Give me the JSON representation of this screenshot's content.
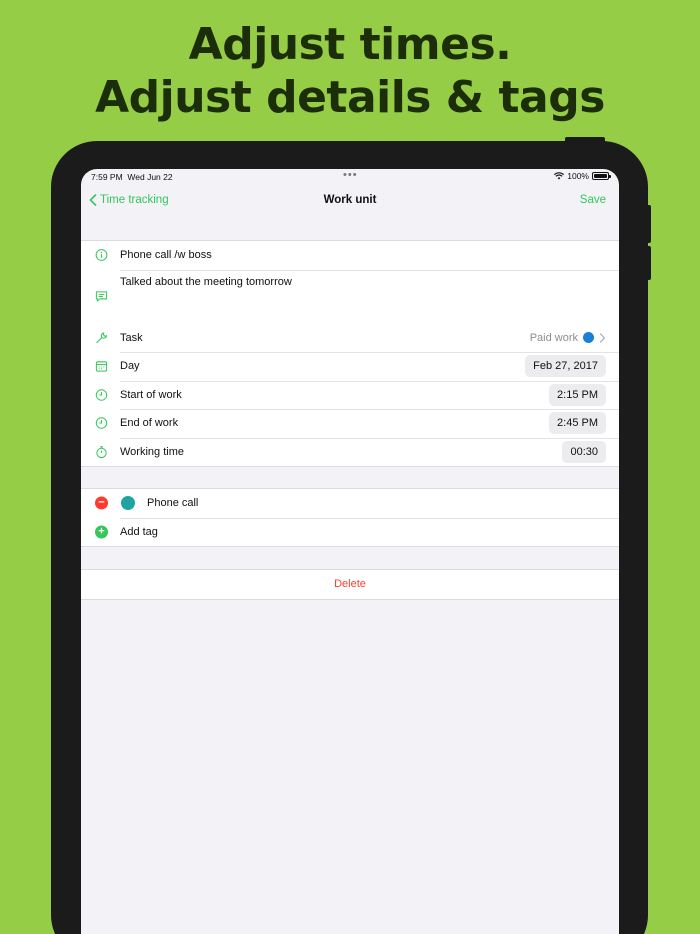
{
  "headline": {
    "line1": "Adjust times.",
    "line2": "Adjust details & tags"
  },
  "status_bar": {
    "time": "7:59 PM",
    "date": "Wed Jun 22",
    "battery": "100%"
  },
  "nav": {
    "back_label": "Time tracking",
    "title": "Work unit",
    "save_label": "Save"
  },
  "details": {
    "title": "Phone call /w boss",
    "notes": "Talked about the meeting tomorrow"
  },
  "fields": {
    "task": {
      "label": "Task",
      "value": "Paid work",
      "color": "#1a7fd6"
    },
    "day": {
      "label": "Day",
      "value": "Feb 27, 2017"
    },
    "start": {
      "label": "Start of work",
      "value": "2:15 PM"
    },
    "end": {
      "label": "End of work",
      "value": "2:45 PM"
    },
    "duration": {
      "label": "Working time",
      "value": "00:30"
    }
  },
  "tags": {
    "items": [
      {
        "label": "Phone call",
        "color": "#1fa3a3"
      }
    ],
    "add_label": "Add tag"
  },
  "actions": {
    "delete_label": "Delete"
  },
  "colors": {
    "background": "#96cd47",
    "accent": "#34c759",
    "destructive": "#ff3b30"
  }
}
